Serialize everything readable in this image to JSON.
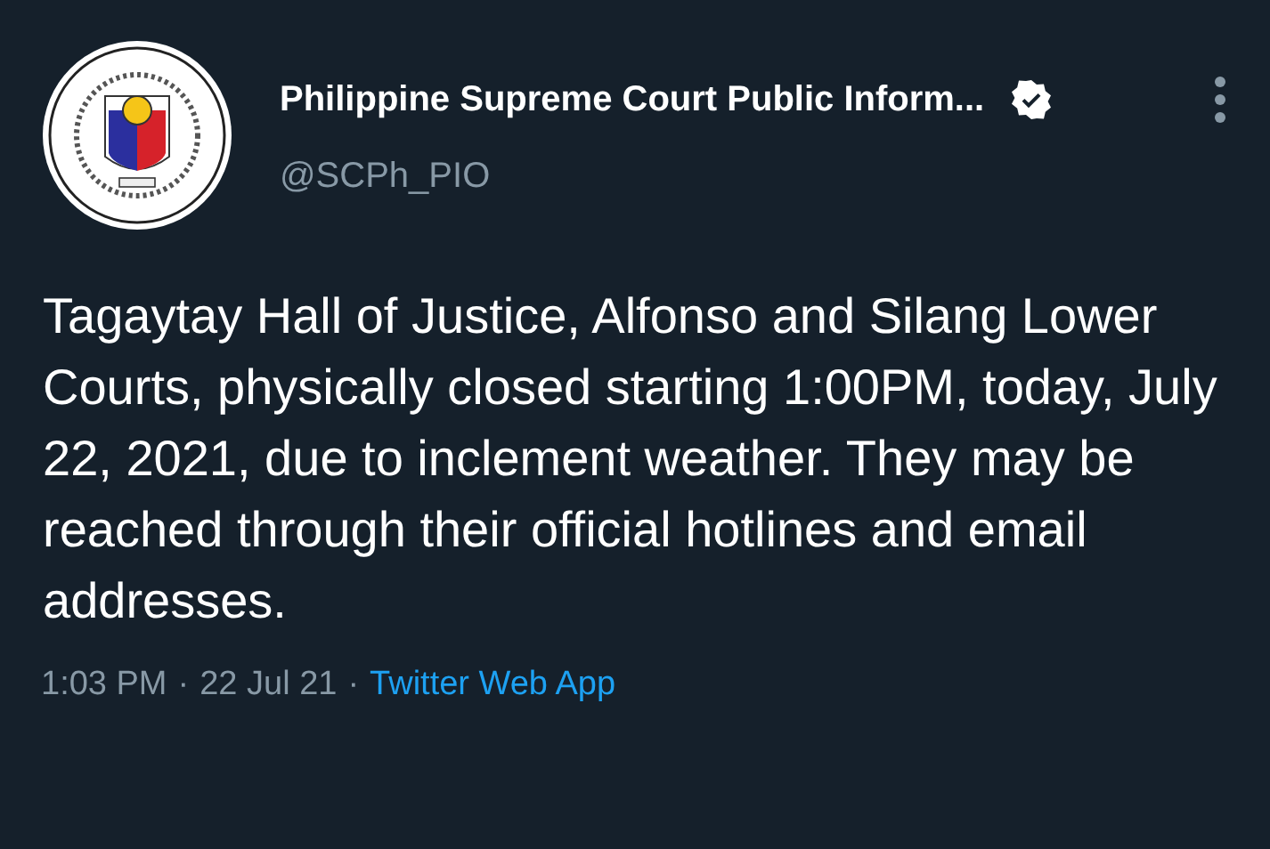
{
  "author": {
    "name": "Philippine Supreme Court Public Inform...",
    "verified": true,
    "handle": "@SCPh_PIO"
  },
  "tweet": {
    "text": "Tagaytay Hall of Justice, Alfonso and Silang Lower Courts, physically closed starting 1:00PM, today, July 22, 2021, due to inclement weather. They may be reached through their official hotlines and email addresses."
  },
  "meta": {
    "time": "1:03 PM",
    "separator": "·",
    "date": "22 Jul 21",
    "source": "Twitter Web App"
  }
}
